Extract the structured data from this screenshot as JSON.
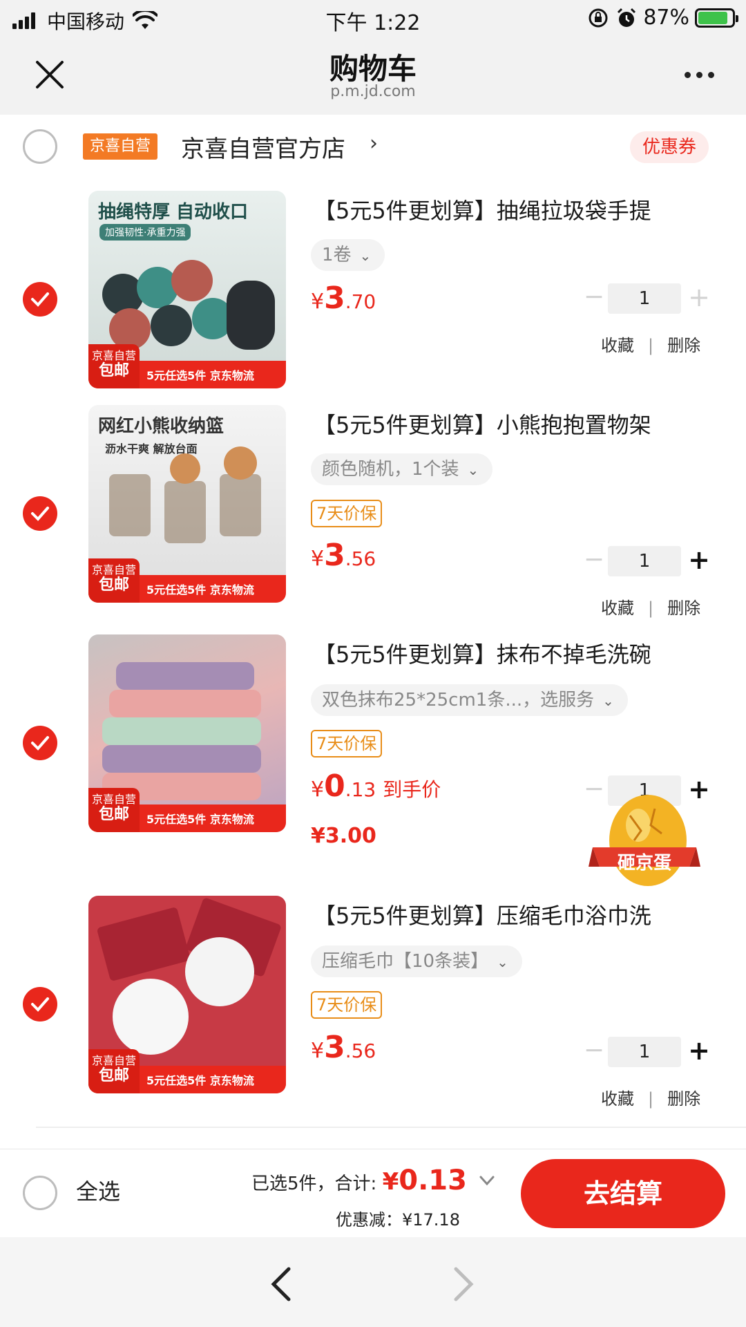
{
  "status_bar": {
    "carrier": "中国移动",
    "time": "下午 1:22",
    "battery": "87%",
    "battery_level": 0.87
  },
  "nav": {
    "title": "购物车",
    "url": "p.m.jd.com"
  },
  "store": {
    "badge": "京喜自营",
    "name": "京喜自营官方店",
    "chevron": "›",
    "coupon": "优惠券"
  },
  "items": [
    {
      "thumb_headline": "抽绳特厚 自动收口",
      "thumb_sub": "加强韧性·承重力强",
      "thumb_tag_top": "京喜自营",
      "thumb_tag_main": "包邮",
      "thumb_tag_text": "5元任选5件 京东物流",
      "title": "【5元5件更划算】抽绳拉圾袋手提",
      "spec": "1卷",
      "price_symbol": "¥",
      "price_int": "3",
      "price_dec": ".70",
      "qty": "1",
      "fav": "收藏",
      "delete": "删除"
    },
    {
      "thumb_headline": "网红小熊收纳篮",
      "thumb_sub": "沥水干爽 解放台面",
      "thumb_tag_top": "京喜自营",
      "thumb_tag_main": "包邮",
      "thumb_tag_text": "5元任选5件 京东物流",
      "title": "【5元5件更划算】小熊抱抱置物架",
      "spec": "颜色随机，1个装",
      "guarantee": "7天价保",
      "price_symbol": "¥",
      "price_int": "3",
      "price_dec": ".56",
      "qty": "1",
      "fav": "收藏",
      "delete": "删除"
    },
    {
      "thumb_tag_top": "京喜自营",
      "thumb_tag_main": "包邮",
      "thumb_tag_text": "5元任选5件 京东物流",
      "title": "【5元5件更划算】抹布不掉毛洗碗",
      "spec": "双色抹布25*25cm1条...，选服务",
      "guarantee": "7天价保",
      "price_symbol": "¥",
      "price_int": "0",
      "price_dec": ".13",
      "price_suffix": "到手价",
      "orig_price": "¥3.00",
      "qty": "1"
    },
    {
      "thumb_tag_top": "京喜自营",
      "thumb_tag_main": "包邮",
      "thumb_tag_text": "5元任选5件 京东物流",
      "title": "【5元5件更划算】压缩毛巾浴巾洗",
      "spec": "压缩毛巾【10条装】",
      "guarantee": "7天价保",
      "price_symbol": "¥",
      "price_int": "3",
      "price_dec": ".56",
      "qty": "1",
      "fav": "收藏",
      "delete": "删除"
    }
  ],
  "floating": {
    "egg_label": "砸京蛋"
  },
  "bottom_bar": {
    "select_all": "全选",
    "selected_summary": "已选5件，合计:",
    "total_symbol": "¥",
    "total": "0.13",
    "discount": "优惠减：¥17.18",
    "checkout": "去结算"
  },
  "colors": {
    "accent": "#e9271c",
    "store_badge": "#f37a24",
    "guarantee": "#e88d18"
  }
}
